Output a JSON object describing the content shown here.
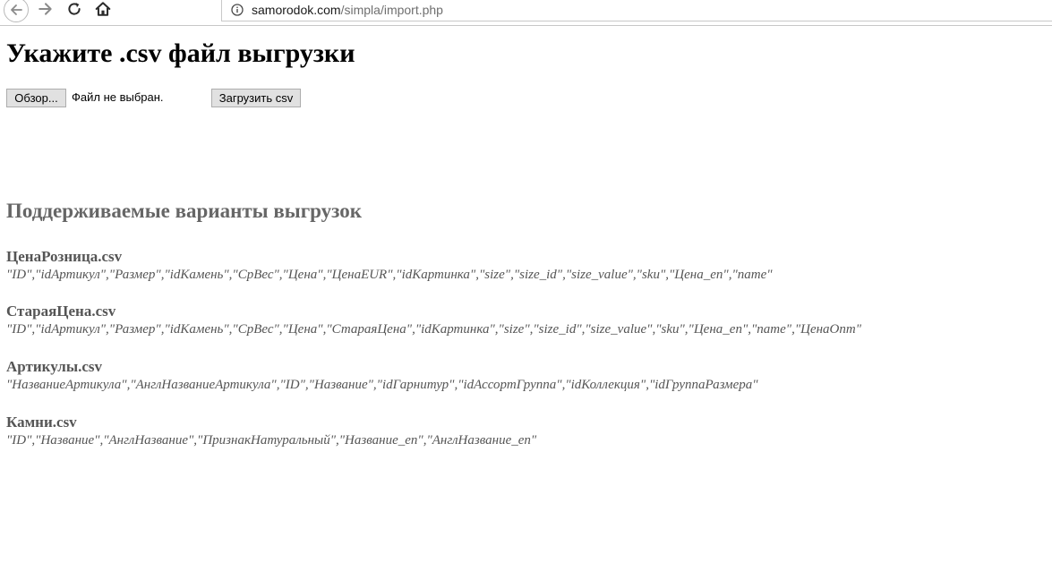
{
  "browser": {
    "url_host": "samorodok.com",
    "url_path": "/simpla/import.php",
    "icons": {
      "back": "back-arrow-icon",
      "forward": "forward-arrow-icon",
      "reload": "reload-icon",
      "home": "home-icon",
      "info": "info-icon"
    }
  },
  "page": {
    "title": "Укажите .csv файл выгрузки",
    "browse_label": "Обзор...",
    "file_status": "Файл не выбран.",
    "upload_label": "Загрузить csv",
    "formats_title": "Поддерживаемые варианты выгрузок",
    "formats": [
      {
        "name": "ЦенаРозница.csv",
        "fields": "\"ID\",\"idАртикул\",\"Размер\",\"idКамень\",\"СрВес\",\"Цена\",\"ЦенаEUR\",\"idКартинка\",\"size\",\"size_id\",\"size_value\",\"sku\",\"Цена_en\",\"name\""
      },
      {
        "name": "СтараяЦена.csv",
        "fields": "\"ID\",\"idАртикул\",\"Размер\",\"idКамень\",\"СрВес\",\"Цена\",\"СтараяЦена\",\"idКартинка\",\"size\",\"size_id\",\"size_value\",\"sku\",\"Цена_en\",\"name\",\"ЦенаОпт\""
      },
      {
        "name": "Артикулы.csv",
        "fields": "\"НазваниеАртикула\",\"АнглНазваниеАртикула\",\"ID\",\"Название\",\"idГарнитур\",\"idАссортГруппа\",\"idКоллекция\",\"idГруппаРазмера\""
      },
      {
        "name": "Камни.csv",
        "fields": "\"ID\",\"Название\",\"АнглНазвание\",\"ПризнакНатуральный\",\"Название_en\",\"АнглНазвание_en\""
      }
    ]
  }
}
